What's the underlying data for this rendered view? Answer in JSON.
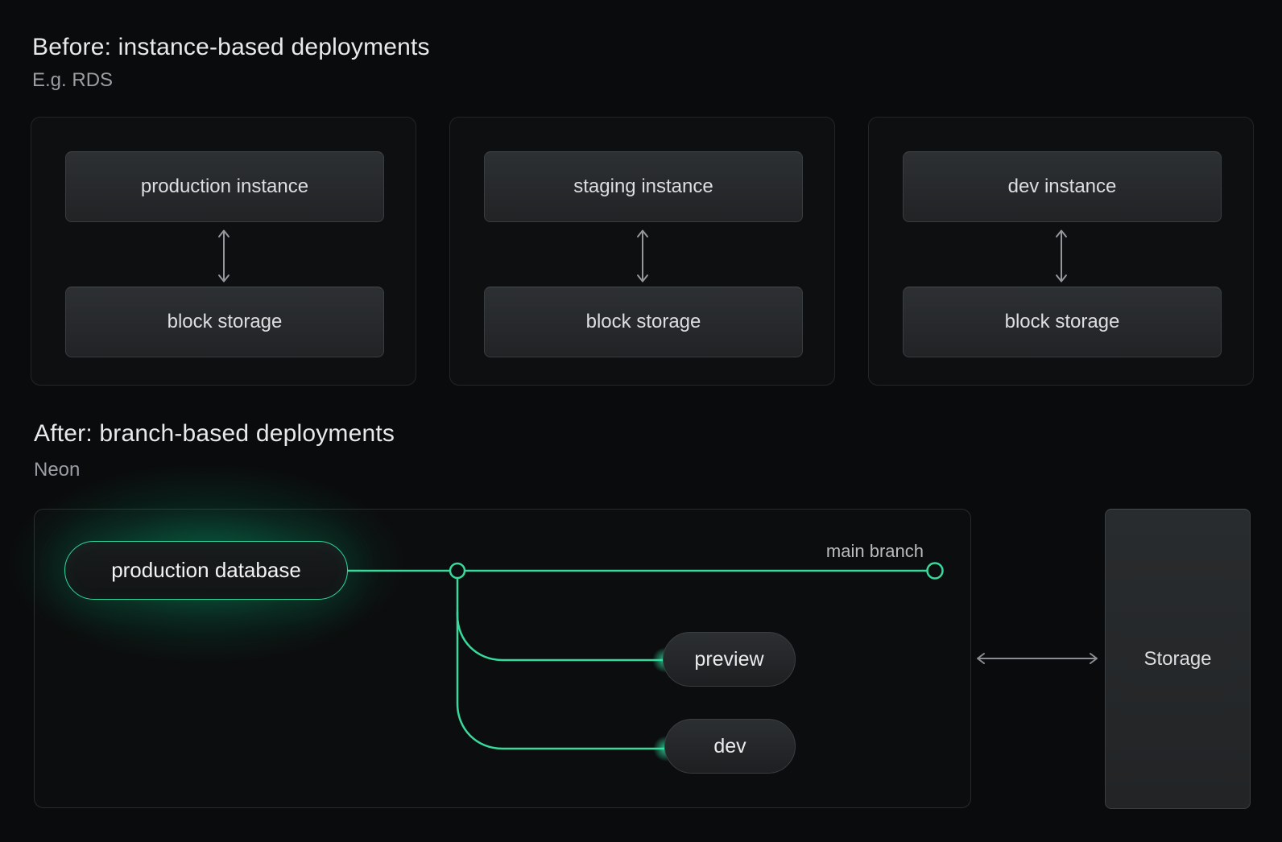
{
  "colors": {
    "accent_green": "#2fd9a0",
    "glow_green": "#00e599",
    "background": "#0a0b0c",
    "arrow_gray": "#8a8e92"
  },
  "before": {
    "title": "Before: instance-based deployments",
    "subtitle": "E.g. RDS",
    "cards": [
      {
        "instance_label": "production instance",
        "storage_label": "block storage"
      },
      {
        "instance_label": "staging instance",
        "storage_label": "block storage"
      },
      {
        "instance_label": "dev instance",
        "storage_label": "block storage"
      }
    ]
  },
  "after": {
    "title": "After: branch-based deployments",
    "subtitle": "Neon",
    "database_label": "production database",
    "main_branch_label": "main branch",
    "branch_labels": [
      "preview",
      "dev"
    ],
    "storage_label": "Storage"
  }
}
